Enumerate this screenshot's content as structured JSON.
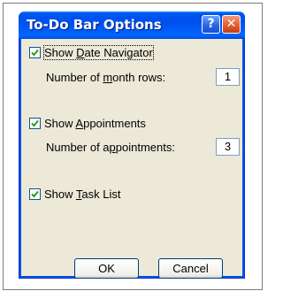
{
  "window": {
    "title": "To-Do Bar Options",
    "help_button": "?",
    "close_button": "✕"
  },
  "options": {
    "date_navigator": {
      "label_pre": "Show ",
      "label_key": "D",
      "label_post": "ate Navigator",
      "checked": true,
      "field_pre": "Number of ",
      "field_key": "m",
      "field_post": "onth rows:",
      "field_value": "1"
    },
    "appointments": {
      "label_pre": "Show ",
      "label_key": "A",
      "label_post": "ppointments",
      "checked": true,
      "field_pre": "Number of a",
      "field_key": "p",
      "field_post": "pointments:",
      "field_value": "3"
    },
    "task_list": {
      "label_pre": "Show ",
      "label_key": "T",
      "label_post": "ask List",
      "checked": true
    }
  },
  "buttons": {
    "ok": "OK",
    "cancel": "Cancel"
  },
  "colors": {
    "title_bar": "#0054e3",
    "dialog_face": "#ece9d8",
    "checkmark": "#21a121"
  }
}
